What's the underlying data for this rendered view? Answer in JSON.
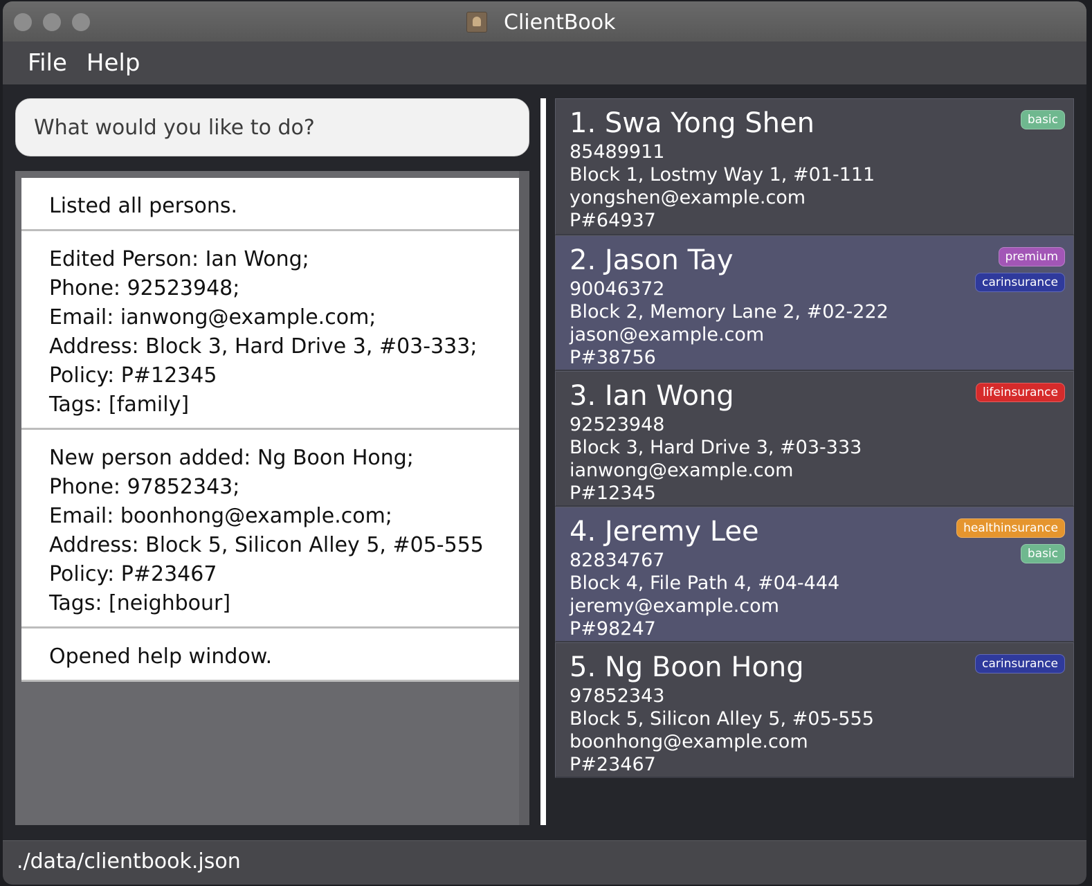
{
  "window": {
    "title": "ClientBook"
  },
  "menu": [
    {
      "label": "File"
    },
    {
      "label": "Help"
    }
  ],
  "command": {
    "placeholder": "What would you like to do?",
    "value": ""
  },
  "results": [
    {
      "lines": [
        "Listed all persons."
      ]
    },
    {
      "lines": [
        "Edited Person: Ian Wong;",
        "Phone: 92523948;",
        "Email: ianwong@example.com;",
        "Address: Block 3, Hard Drive 3, #03-333;",
        "Policy: P#12345",
        "Tags: [family]"
      ]
    },
    {
      "lines": [
        "New person added: Ng Boon Hong;",
        "Phone: 97852343;",
        "Email: boonhong@example.com;",
        "Address: Block 5, Silicon Alley 5, #05-555",
        "Policy: P#23467",
        "Tags: [neighbour]"
      ]
    },
    {
      "lines": [
        "Opened help window."
      ]
    }
  ],
  "persons": [
    {
      "name": "1. Swa Yong Shen",
      "phone": "85489911",
      "address": "Block 1, Lostmy Way 1, #01-111",
      "email": "yongshen@example.com",
      "policy": "P#64937",
      "tags": [
        {
          "label": "basic",
          "color": "#6fb88f"
        }
      ]
    },
    {
      "name": "2. Jason Tay",
      "phone": "90046372",
      "address": "Block 2, Memory Lane 2, #02-222",
      "email": "jason@example.com",
      "policy": "P#38756",
      "tags": [
        {
          "label": "premium",
          "color": "#a256b6"
        },
        {
          "label": "carinsurance",
          "color": "#2f3a9c"
        }
      ]
    },
    {
      "name": "3. Ian Wong",
      "phone": "92523948",
      "address": "Block 3, Hard Drive 3, #03-333",
      "email": "ianwong@example.com",
      "policy": "P#12345",
      "tags": [
        {
          "label": "lifeinsurance",
          "color": "#d62b2b"
        }
      ]
    },
    {
      "name": "4. Jeremy Lee",
      "phone": "82834767",
      "address": "Block 4, File Path 4, #04-444",
      "email": "jeremy@example.com",
      "policy": "P#98247",
      "tags": [
        {
          "label": "healthinsurance",
          "color": "#e5952e"
        },
        {
          "label": "basic",
          "color": "#6fb88f"
        }
      ]
    },
    {
      "name": "5. Ng Boon Hong",
      "phone": "97852343",
      "address": "Block 5, Silicon Alley 5, #05-555",
      "email": "boonhong@example.com",
      "policy": "P#23467",
      "tags": [
        {
          "label": "carinsurance",
          "color": "#2f3a9c"
        }
      ]
    }
  ],
  "status": {
    "path": "./data/clientbook.json"
  }
}
